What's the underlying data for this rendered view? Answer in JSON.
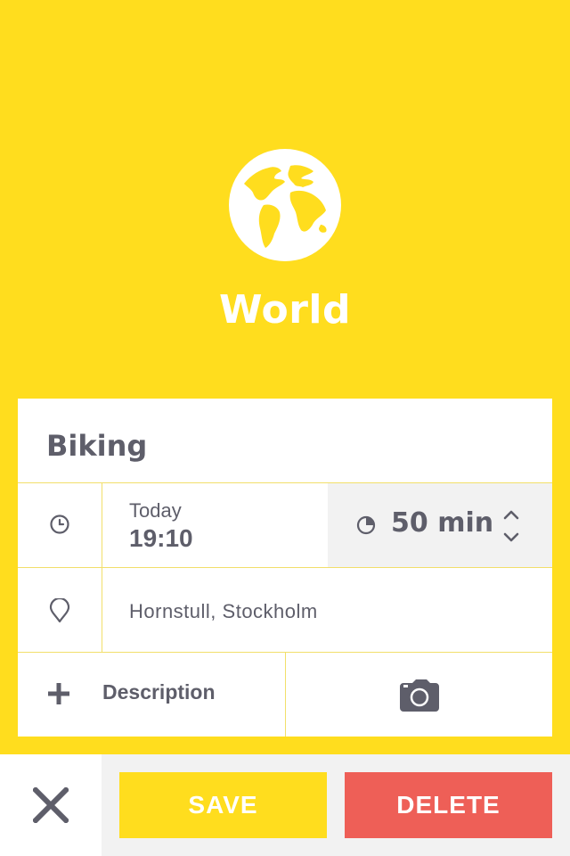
{
  "colors": {
    "accent": "#FFDD1E",
    "text": "#5E5E6A",
    "danger": "#EE5F57",
    "panel": "#F2F2F2"
  },
  "header": {
    "icon": "globe-icon",
    "title": "World"
  },
  "activity": {
    "name": "Biking"
  },
  "time": {
    "icon": "clock-icon",
    "day": "Today",
    "time": "19:10"
  },
  "duration": {
    "icon": "pie-icon",
    "value": "50 min",
    "stepper_icon": "up-down-chevron-icon"
  },
  "location": {
    "icon": "location-pin-icon",
    "value": "Hornstull, Stockholm"
  },
  "description": {
    "icon": "plus-icon",
    "label": "Description"
  },
  "photo": {
    "icon": "camera-icon"
  },
  "actions": {
    "close_icon": "close-icon",
    "save_label": "SAVE",
    "delete_label": "DELETE"
  }
}
